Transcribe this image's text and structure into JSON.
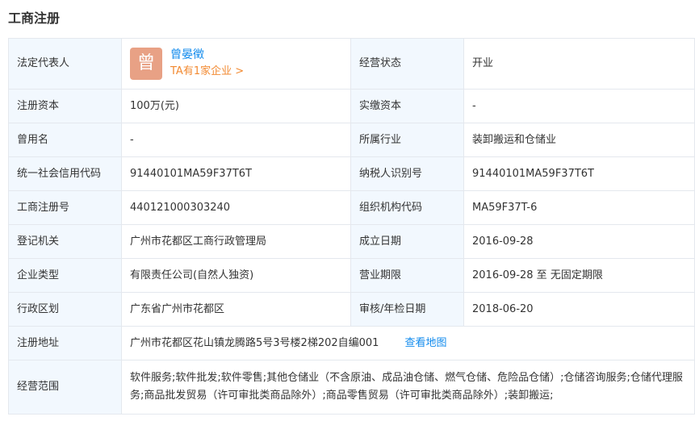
{
  "section_title": "工商注册",
  "legal_rep": {
    "label": "法定代表人",
    "avatar_char": "曾",
    "name": "曾晏徵",
    "link": "TA有1家企业 >",
    "status_label": "经营状态",
    "status_value": "开业"
  },
  "rows": [
    {
      "l1": "注册资本",
      "v1": "100万(元)",
      "l2": "实缴资本",
      "v2": "-"
    },
    {
      "l1": "曾用名",
      "v1": "-",
      "l2": "所属行业",
      "v2": "装卸搬运和仓储业"
    },
    {
      "l1": "统一社会信用代码",
      "v1": "91440101MA59F37T6T",
      "l2": "纳税人识别号",
      "v2": "91440101MA59F37T6T"
    },
    {
      "l1": "工商注册号",
      "v1": "440121000303240",
      "l2": "组织机构代码",
      "v2": "MA59F37T-6"
    },
    {
      "l1": "登记机关",
      "v1": "广州市花都区工商行政管理局",
      "l2": "成立日期",
      "v2": "2016-09-28"
    },
    {
      "l1": "企业类型",
      "v1": "有限责任公司(自然人独资)",
      "l2": "营业期限",
      "v2": "2016-09-28 至 无固定期限"
    },
    {
      "l1": "行政区划",
      "v1": "广东省广州市花都区",
      "l2": "审核/年检日期",
      "v2": "2018-06-20"
    }
  ],
  "address": {
    "label": "注册地址",
    "value": "广州市花都区花山镇龙腾路5号3号楼2梯202自编001",
    "map_link": "查看地图"
  },
  "scope": {
    "label": "经营范围",
    "value": "软件服务;软件批发;软件零售;其他仓储业（不含原油、成品油仓储、燃气仓储、危险品仓储）;仓储咨询服务;仓储代理服务;商品批发贸易（许可审批类商品除外）;商品零售贸易（许可审批类商品除外）;装卸搬运;"
  },
  "colors": {
    "label_bg": "#f2f8fe",
    "border": "#e4e8ee",
    "link_blue": "#128bed",
    "link_orange": "#f28a32",
    "avatar_bg": "#e8a185"
  }
}
